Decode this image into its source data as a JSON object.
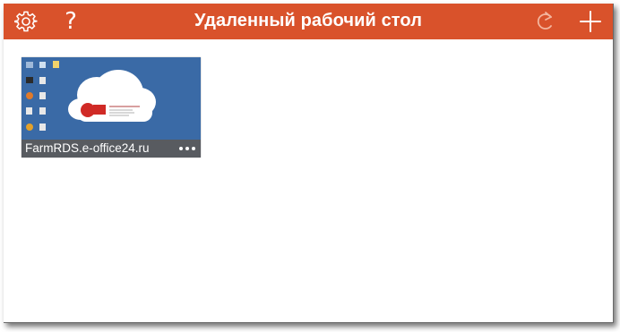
{
  "header": {
    "title": "Удаленный рабочий стол",
    "color": "#d9522b",
    "settings_icon": "gear-icon",
    "help_icon": "question-icon",
    "help_glyph": "?",
    "refresh_icon": "refresh-icon",
    "add_icon": "plus-icon"
  },
  "connections": [
    {
      "name": "FarmRDS.e-office24.ru",
      "thumbnail_logo": "e24",
      "more_icon": "ellipsis-icon"
    }
  ]
}
